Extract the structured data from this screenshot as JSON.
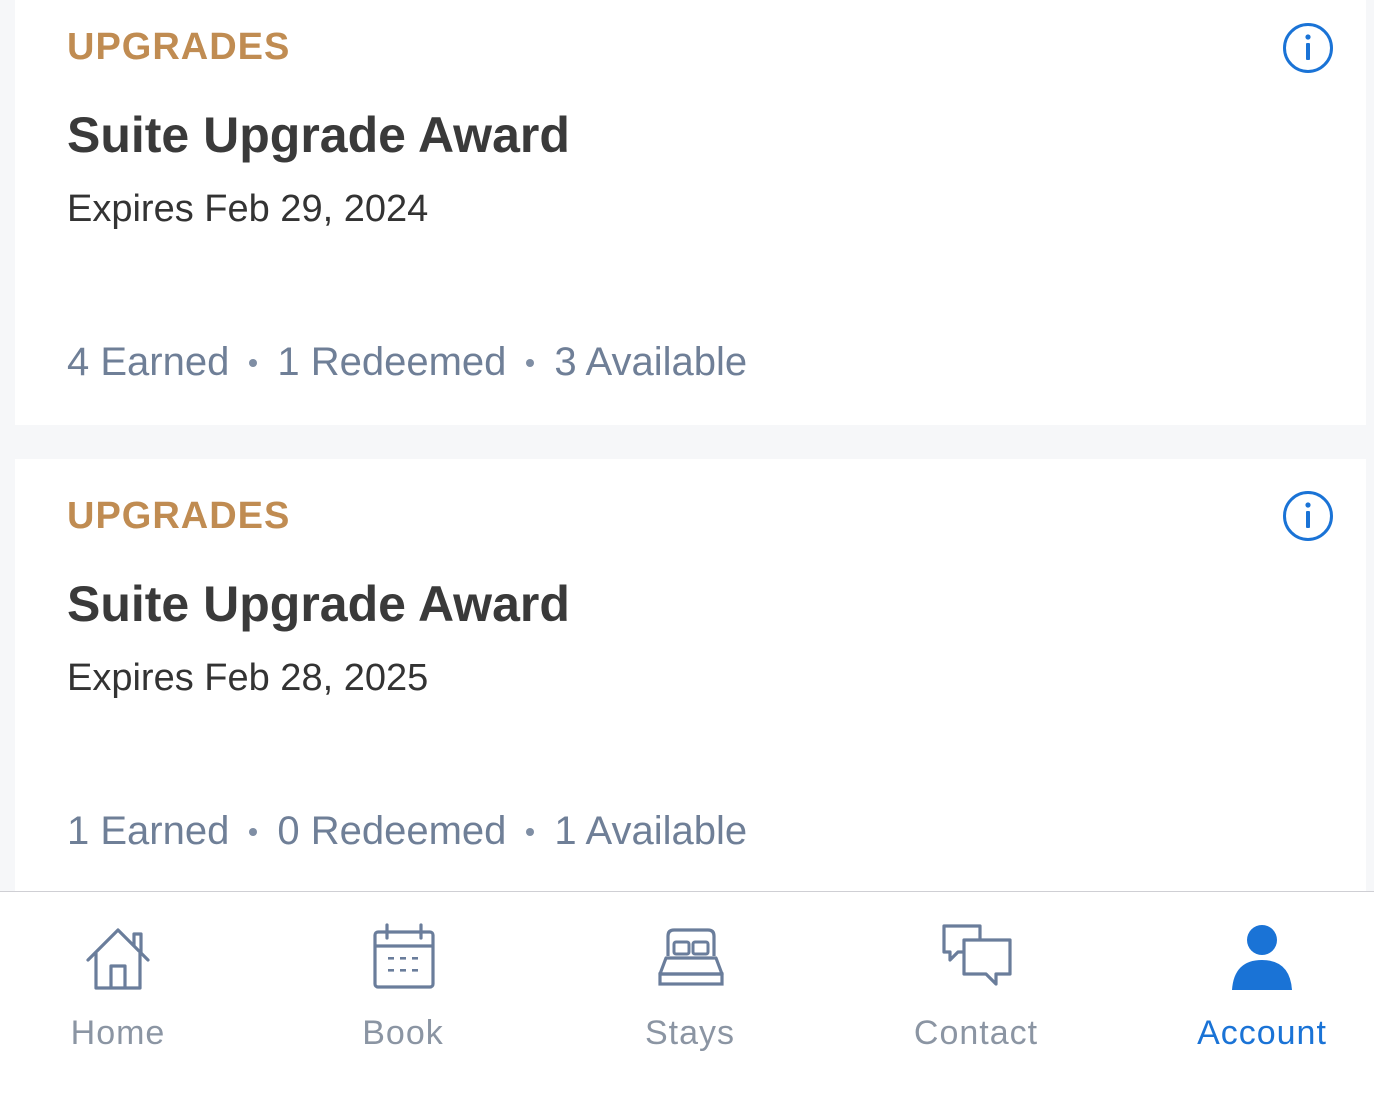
{
  "cards": [
    {
      "category": "UPGRADES",
      "title": "Suite Upgrade Award",
      "expires": "Expires Feb 29, 2024",
      "earned": "4 Earned",
      "redeemed": "1 Redeemed",
      "available": "3 Available"
    },
    {
      "category": "UPGRADES",
      "title": "Suite Upgrade Award",
      "expires": "Expires Feb 28, 2025",
      "earned": "1 Earned",
      "redeemed": "0 Redeemed",
      "available": "1 Available"
    }
  ],
  "tabbar": {
    "home": "Home",
    "book": "Book",
    "stays": "Stays",
    "contact": "Contact",
    "account": "Account"
  },
  "colors": {
    "category": "#c08c52",
    "accent": "#1a73d6",
    "inactive": "#8b95a3",
    "stats": "#6f7f97"
  }
}
